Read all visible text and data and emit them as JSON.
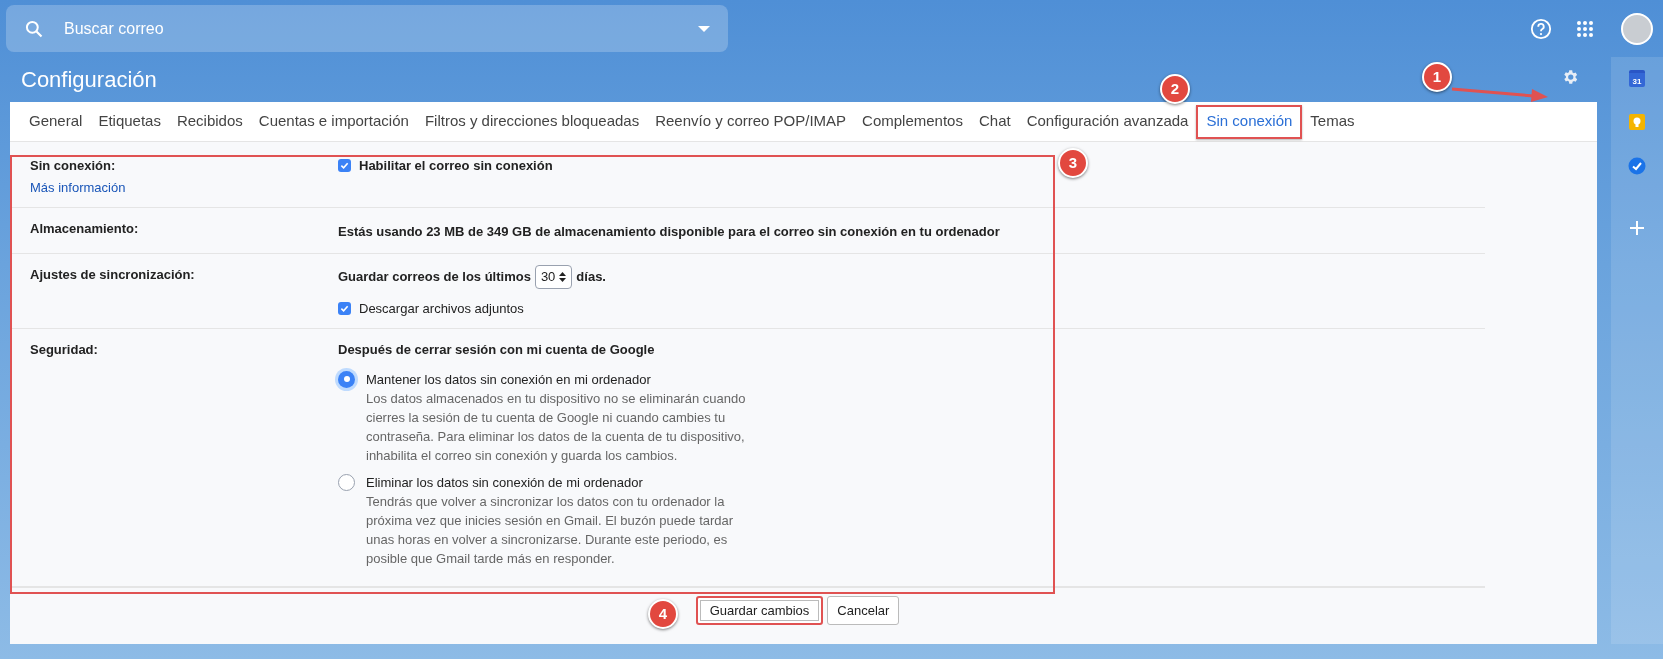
{
  "search": {
    "placeholder": "Buscar correo"
  },
  "page_title": "Configuración",
  "tabs": [
    {
      "label": "General",
      "selected": false
    },
    {
      "label": "Etiquetas",
      "selected": false
    },
    {
      "label": "Recibidos",
      "selected": false
    },
    {
      "label": "Cuentas e importación",
      "selected": false
    },
    {
      "label": "Filtros y direcciones bloqueadas",
      "selected": false
    },
    {
      "label": "Reenvío y correo POP/IMAP",
      "selected": false
    },
    {
      "label": "Complementos",
      "selected": false
    },
    {
      "label": "Chat",
      "selected": false
    },
    {
      "label": "Configuración avanzada",
      "selected": false
    },
    {
      "label": "Sin conexión",
      "selected": true
    },
    {
      "label": "Temas",
      "selected": false
    }
  ],
  "sections": [
    {
      "kind": "toggle",
      "label": "Sin conexión:",
      "link": "Más información",
      "checkbox": {
        "label": "Habilitar el correo sin conexión",
        "checked": true
      }
    },
    {
      "kind": "text",
      "label": "Almacenamiento:",
      "text": "Estás usando 23 MB de 349 GB de almacenamiento disponible para el correo sin conexión en tu ordenador"
    },
    {
      "kind": "sync",
      "label": "Ajustes de sincronización:",
      "prefix": "Guardar correos de los últimos",
      "days": "30",
      "suffix": "días.",
      "checkbox": {
        "label": "Descargar archivos adjuntos",
        "checked": true
      }
    },
    {
      "kind": "radio",
      "label": "Seguridad:",
      "heading": "Después de cerrar sesión con mi cuenta de Google",
      "options": [
        {
          "label": "Mantener los datos sin conexión en mi ordenador",
          "description": "Los datos almacenados en tu dispositivo no se eliminarán cuando cierres la sesión de tu cuenta de Google ni cuando cambies tu contraseña. Para eliminar los datos de la cuenta de tu dispositivo, inhabilita el correo sin conexión y guarda los cambios.",
          "selected": true
        },
        {
          "label": "Eliminar los datos sin conexión de mi ordenador",
          "description": "Tendrás que volver a sincronizar los datos con tu ordenador la próxima vez que inicies sesión en Gmail. El buzón puede tardar unas horas en volver a sincronizarse. Durante este periodo, es posible que Gmail tarde más en responder.",
          "selected": false
        }
      ]
    }
  ],
  "buttons": [
    {
      "label": "Guardar cambios",
      "highlighted": true
    },
    {
      "label": "Cancelar",
      "highlighted": false
    }
  ],
  "side_panel": {
    "calendar_badge": "31"
  },
  "callouts": [
    "1",
    "2",
    "3",
    "4"
  ]
}
